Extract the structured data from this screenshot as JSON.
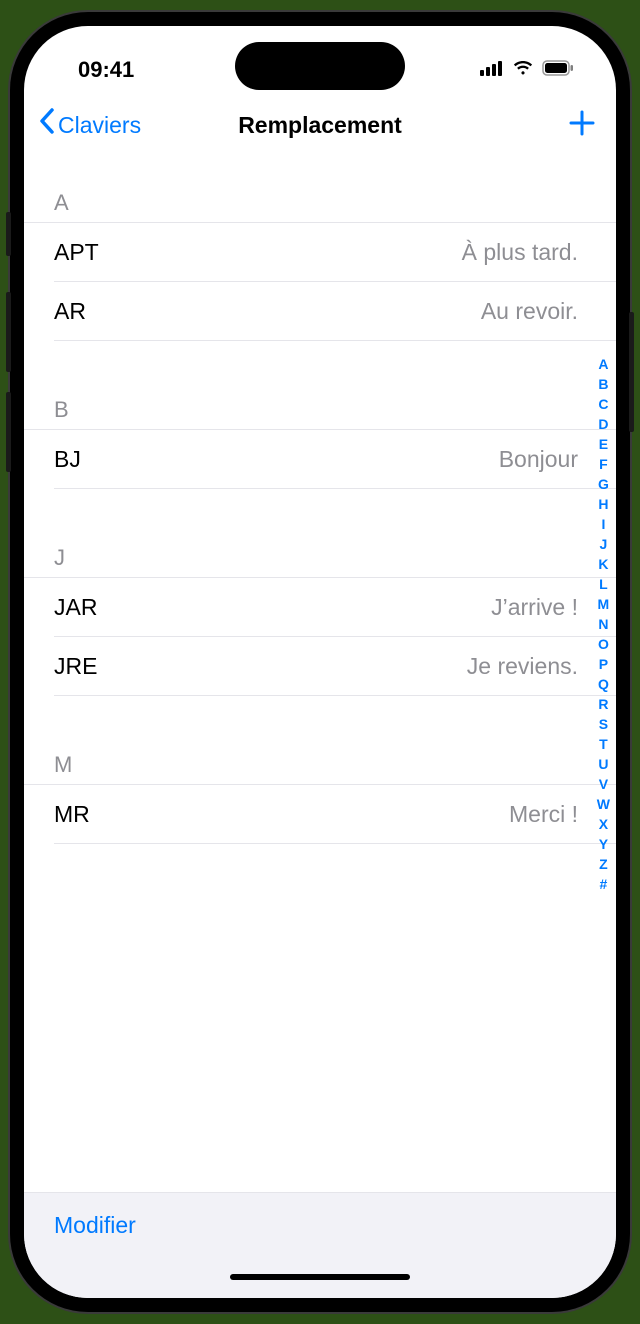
{
  "status": {
    "time": "09:41"
  },
  "nav": {
    "back_label": "Claviers",
    "title": "Remplacement"
  },
  "sections": [
    {
      "header": "A",
      "rows": [
        {
          "shortcut": "APT",
          "phrase": "À plus tard."
        },
        {
          "shortcut": "AR",
          "phrase": "Au revoir."
        }
      ]
    },
    {
      "header": "B",
      "rows": [
        {
          "shortcut": "BJ",
          "phrase": "Bonjour"
        }
      ]
    },
    {
      "header": "J",
      "rows": [
        {
          "shortcut": "JAR",
          "phrase": "J’arrive !"
        },
        {
          "shortcut": "JRE",
          "phrase": "Je reviens."
        }
      ]
    },
    {
      "header": "M",
      "rows": [
        {
          "shortcut": "MR",
          "phrase": "Merci !"
        }
      ]
    }
  ],
  "index": [
    "A",
    "B",
    "C",
    "D",
    "E",
    "F",
    "G",
    "H",
    "I",
    "J",
    "K",
    "L",
    "M",
    "N",
    "O",
    "P",
    "Q",
    "R",
    "S",
    "T",
    "U",
    "V",
    "W",
    "X",
    "Y",
    "Z",
    "#"
  ],
  "toolbar": {
    "edit_label": "Modifier"
  }
}
